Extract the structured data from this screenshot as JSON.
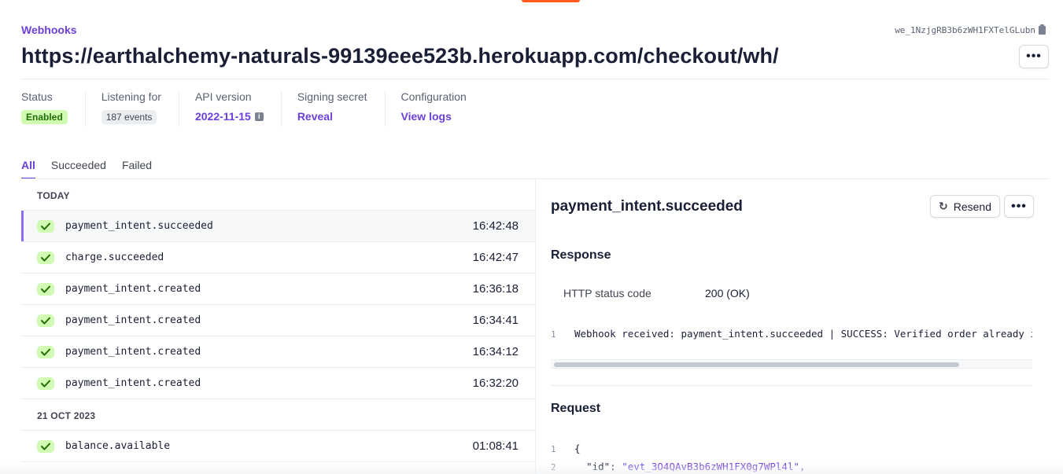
{
  "header": {
    "breadcrumb": "Webhooks",
    "endpoint_id": "we_1NzjgRB3b6zWH1FXTelGLubn",
    "title": "https://earthalchemy-naturals-99139eee523b.herokuapp.com/checkout/wh/",
    "more_label": "•••"
  },
  "meta": {
    "status_label": "Status",
    "status_value": "Enabled",
    "listening_label": "Listening for",
    "listening_value": "187 events",
    "api_label": "API version",
    "api_value": "2022-11-15",
    "secret_label": "Signing secret",
    "secret_value": "Reveal",
    "config_label": "Configuration",
    "config_value": "View logs"
  },
  "tabs": [
    {
      "label": "All",
      "active": true
    },
    {
      "label": "Succeeded",
      "active": false
    },
    {
      "label": "Failed",
      "active": false
    }
  ],
  "event_groups": [
    {
      "header": "TODAY",
      "events": [
        {
          "name": "payment_intent.succeeded",
          "time": "16:42:48",
          "selected": true
        },
        {
          "name": "charge.succeeded",
          "time": "16:42:47"
        },
        {
          "name": "payment_intent.created",
          "time": "16:36:18"
        },
        {
          "name": "payment_intent.created",
          "time": "16:34:41"
        },
        {
          "name": "payment_intent.created",
          "time": "16:34:12"
        },
        {
          "name": "payment_intent.created",
          "time": "16:32:20"
        }
      ]
    },
    {
      "header": "21 OCT 2023",
      "events": [
        {
          "name": "balance.available",
          "time": "01:08:41"
        }
      ]
    }
  ],
  "detail": {
    "title": "payment_intent.succeeded",
    "resend_label": "Resend",
    "more_label": "•••",
    "response_title": "Response",
    "status_code_label": "HTTP status code",
    "status_code_value": "200 (OK)",
    "response_line_no": "1",
    "response_body": "Webhook received: payment_intent.succeeded | SUCCESS: Verified order already in database",
    "request_title": "Request",
    "request_lines": [
      {
        "no": "1",
        "text": "{"
      },
      {
        "no": "2",
        "key": "\"id\"",
        "value": "\"evt_3O4QAvB3b6zWH1FX0g7WPl4l\","
      }
    ]
  }
}
